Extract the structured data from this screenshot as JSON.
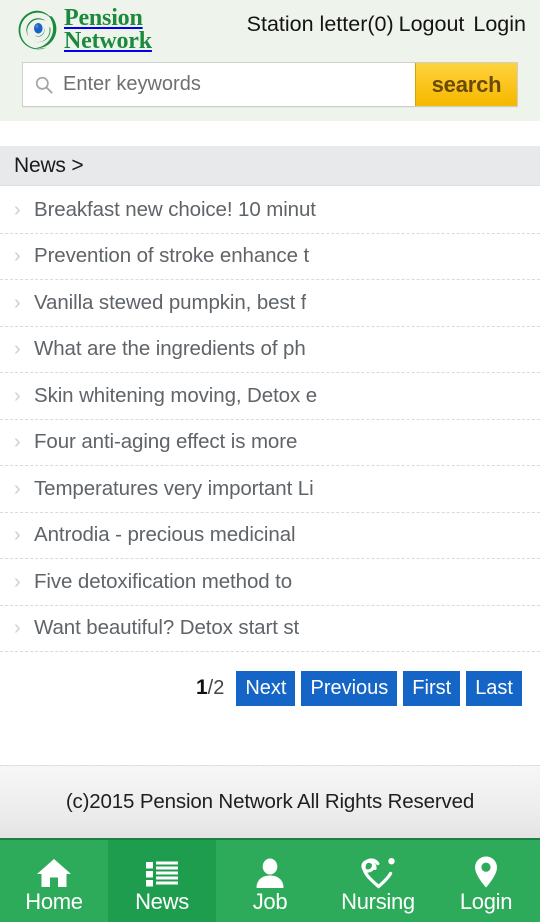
{
  "header": {
    "logo": {
      "line1": "Pension",
      "line2": "Network",
      "icon": "pension-network-swirl-logo",
      "brand_color": "#1c8a3c",
      "droplet_color": "#1c63c6"
    },
    "links": {
      "station_letter": "Station letter(0)",
      "logout": "Logout",
      "login": "Login"
    }
  },
  "search": {
    "icon": "search-icon",
    "placeholder": "Enter keywords",
    "value": "",
    "button_label": "search",
    "button_color": "#fbc51d"
  },
  "breadcrumb": {
    "text": "News >"
  },
  "news": {
    "items": [
      {
        "title": "Breakfast new choice! 10 minut"
      },
      {
        "title": "Prevention of stroke enhance t"
      },
      {
        "title": "Vanilla stewed pumpkin, best f"
      },
      {
        "title": "What are the ingredients of ph"
      },
      {
        "title": "Skin whitening moving, Detox e"
      },
      {
        "title": "Four anti-aging effect is more"
      },
      {
        "title": "Temperatures very important Li"
      },
      {
        "title": "Antrodia - precious medicinal"
      },
      {
        "title": "Five detoxification method to"
      },
      {
        "title": "Want beautiful? Detox start st"
      }
    ],
    "chevron": "chevron-right-icon"
  },
  "pager": {
    "current_page": "1",
    "total_pages": "/2",
    "buttons": [
      {
        "label": "Next"
      },
      {
        "label": "Previous"
      },
      {
        "label": "First"
      },
      {
        "label": "Last"
      }
    ],
    "button_color": "#1565c6"
  },
  "footer": {
    "copyright": "(c)2015 Pension Network All Rights Reserved"
  },
  "bottom_nav": {
    "accent_color": "#2eab5a",
    "active_color": "#1f9d4e",
    "tabs": [
      {
        "label": "Home",
        "icon": "home-icon",
        "active": false
      },
      {
        "label": "News",
        "icon": "list-icon",
        "active": true
      },
      {
        "label": "Job",
        "icon": "person-icon",
        "active": false
      },
      {
        "label": "Nursing",
        "icon": "heart-care-icon",
        "active": false
      },
      {
        "label": "Login",
        "icon": "map-pin-icon",
        "active": false
      }
    ]
  }
}
